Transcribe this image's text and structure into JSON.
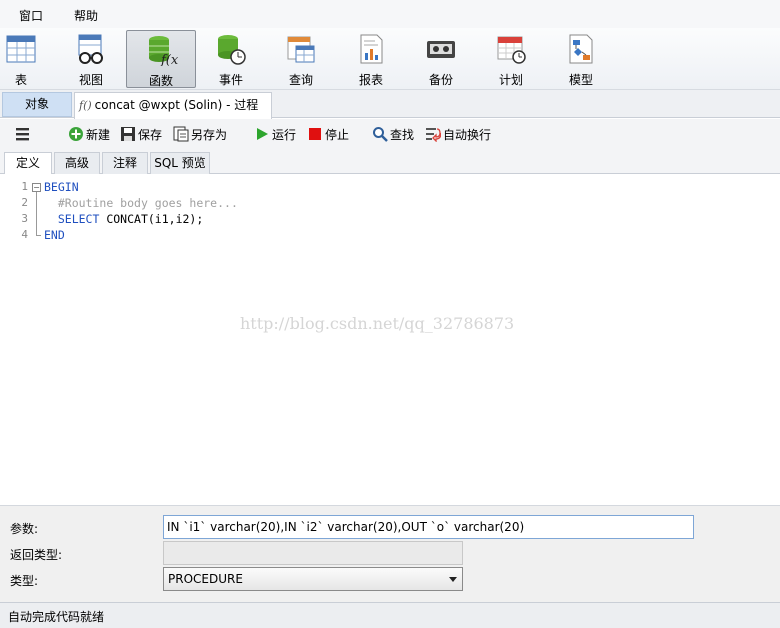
{
  "menu": {
    "items": [
      "窗口",
      "帮助"
    ]
  },
  "toolbar": {
    "items": [
      {
        "label": "表",
        "icon": "table-icon"
      },
      {
        "label": "视图",
        "icon": "view-glasses-icon"
      },
      {
        "label": "函数",
        "icon": "function-database-icon",
        "active": true
      },
      {
        "label": "事件",
        "icon": "event-clock-icon"
      },
      {
        "label": "查询",
        "icon": "query-grid-icon"
      },
      {
        "label": "报表",
        "icon": "report-chart-icon"
      },
      {
        "label": "备份",
        "icon": "backup-tape-icon"
      },
      {
        "label": "计划",
        "icon": "schedule-calendar-icon"
      },
      {
        "label": "模型",
        "icon": "model-diagram-icon"
      }
    ]
  },
  "object_tabs": {
    "objects_label": "对象",
    "proc_prefix": "f()",
    "proc_label": "concat @wxpt (Solin) - 过程"
  },
  "edit_toolbar": {
    "menu_icon": "hamburger-icon",
    "new_label": "新建",
    "save_label": "保存",
    "save_as_label": "另存为",
    "run_label": "运行",
    "stop_label": "停止",
    "find_label": "查找",
    "wrap_label": "自动换行"
  },
  "sub_tabs": [
    "定义",
    "高级",
    "注释",
    "SQL 预览"
  ],
  "editor": {
    "line_numbers": [
      "1",
      "2",
      "3",
      "4"
    ],
    "lines": {
      "l1_kw": "BEGIN",
      "l2_comment": "#Routine body goes here...",
      "l3_kw": "SELECT",
      "l3_rest": " CONCAT(i1,i2);",
      "l4_kw": "END"
    },
    "watermark": "http://blog.csdn.net/qq_32786873"
  },
  "properties": {
    "params_label": "参数:",
    "params_value": "IN `i1` varchar(20),IN `i2` varchar(20),OUT `o` varchar(20)",
    "return_type_label": "返回类型:",
    "return_type_value": "",
    "type_label": "类型:",
    "type_value": "PROCEDURE"
  },
  "status": {
    "text": "自动完成代码就绪"
  },
  "colors": {
    "keyword": "#1f4fbf",
    "comment": "#a0a0a0",
    "selected_tab": "#cfe0f4",
    "run_green": "#2da52d",
    "stop_red": "#e01010"
  }
}
